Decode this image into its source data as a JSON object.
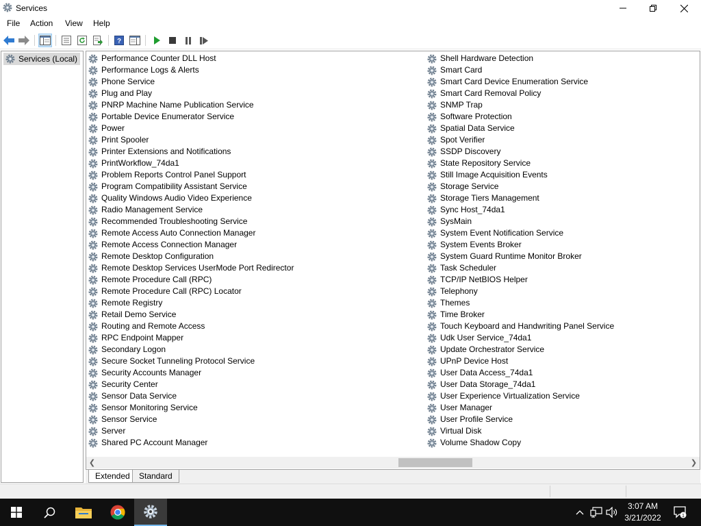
{
  "window": {
    "title": "Services",
    "controls": {
      "minimize": "minimize",
      "maximize": "restore",
      "close": "close"
    }
  },
  "menu": [
    "File",
    "Action",
    "View",
    "Help"
  ],
  "toolbar": {
    "buttons": [
      "back",
      "forward",
      "show-hide-console-tree",
      "properties",
      "refresh",
      "export-list",
      "help",
      "show-action-pane",
      "start-service",
      "stop-service",
      "pause-service",
      "resume-service"
    ]
  },
  "tree": {
    "root_label": "Services (Local)"
  },
  "services": {
    "left": [
      "Performance Counter DLL Host",
      "Performance Logs & Alerts",
      "Phone Service",
      "Plug and Play",
      "PNRP Machine Name Publication Service",
      "Portable Device Enumerator Service",
      "Power",
      "Print Spooler",
      "Printer Extensions and Notifications",
      "PrintWorkflow_74da1",
      "Problem Reports Control Panel Support",
      "Program Compatibility Assistant Service",
      "Quality Windows Audio Video Experience",
      "Radio Management Service",
      "Recommended Troubleshooting Service",
      "Remote Access Auto Connection Manager",
      "Remote Access Connection Manager",
      "Remote Desktop Configuration",
      "Remote Desktop Services UserMode Port Redirector",
      "Remote Procedure Call (RPC)",
      "Remote Procedure Call (RPC) Locator",
      "Remote Registry",
      "Retail Demo Service",
      "Routing and Remote Access",
      "RPC Endpoint Mapper",
      "Secondary Logon",
      "Secure Socket Tunneling Protocol Service",
      "Security Accounts Manager",
      "Security Center",
      "Sensor Data Service",
      "Sensor Monitoring Service",
      "Sensor Service",
      "Server",
      "Shared PC Account Manager"
    ],
    "right": [
      "Shell Hardware Detection",
      "Smart Card",
      "Smart Card Device Enumeration Service",
      "Smart Card Removal Policy",
      "SNMP Trap",
      "Software Protection",
      "Spatial Data Service",
      "Spot Verifier",
      "SSDP Discovery",
      "State Repository Service",
      "Still Image Acquisition Events",
      "Storage Service",
      "Storage Tiers Management",
      "Sync Host_74da1",
      "SysMain",
      "System Event Notification Service",
      "System Events Broker",
      "System Guard Runtime Monitor Broker",
      "Task Scheduler",
      "TCP/IP NetBIOS Helper",
      "Telephony",
      "Themes",
      "Time Broker",
      "Touch Keyboard and Handwriting Panel Service",
      "Udk User Service_74da1",
      "Update Orchestrator Service",
      "UPnP Device Host",
      "User Data Access_74da1",
      "User Data Storage_74da1",
      "User Experience Virtualization Service",
      "User Manager",
      "User Profile Service",
      "Virtual Disk",
      "Volume Shadow Copy"
    ]
  },
  "tabs": [
    {
      "label": "Extended",
      "selected": true
    },
    {
      "label": "Standard",
      "selected": false
    }
  ],
  "taskbar": {
    "apps": [
      "start-button",
      "search-button",
      "file-explorer",
      "chrome",
      "services"
    ],
    "clock": {
      "time": "3:07 AM",
      "date": "3/21/2022"
    },
    "notification_count": "1"
  },
  "colors": {
    "selection": "#cce4f7",
    "tree_selected": "#d9d9d9",
    "taskbar": "#101010",
    "play_green": "#1f9d2f",
    "accent_blue": "#2f7bd1"
  }
}
